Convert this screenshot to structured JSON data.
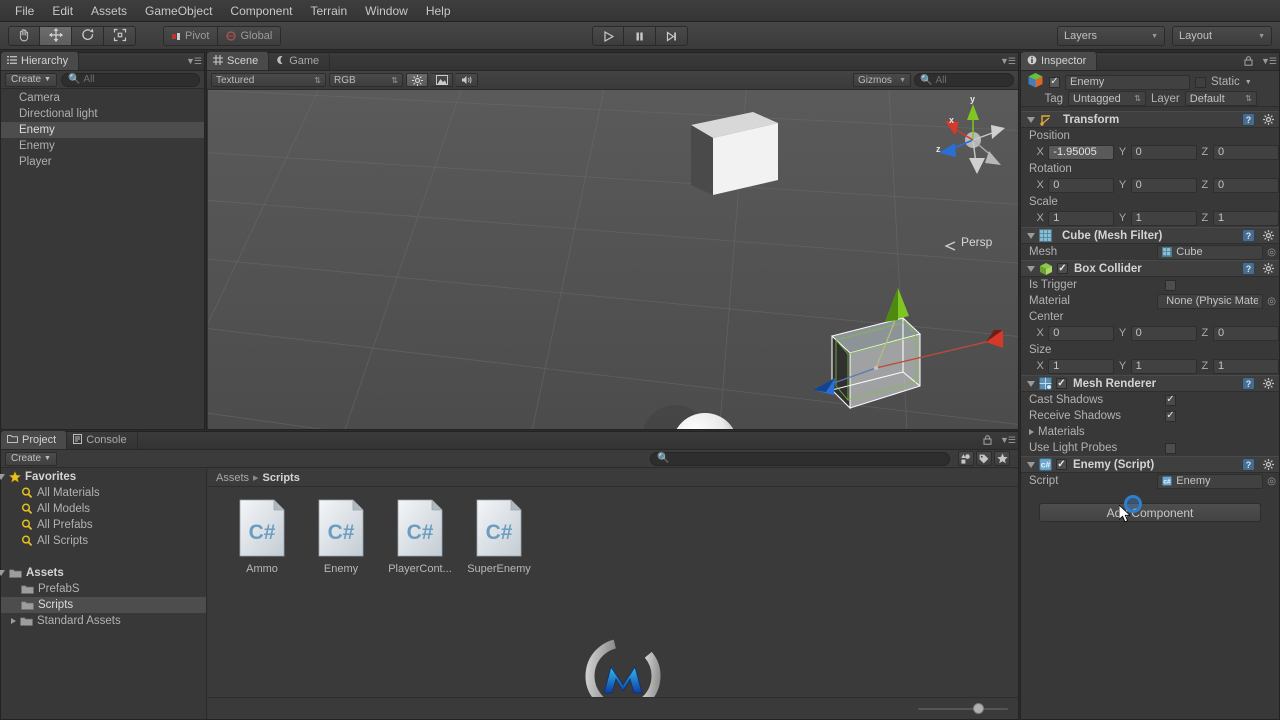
{
  "menu": {
    "items": [
      "File",
      "Edit",
      "Assets",
      "GameObject",
      "Component",
      "Terrain",
      "Window",
      "Help"
    ]
  },
  "toolbar": {
    "tools": [
      {
        "name": "hand-tool",
        "glyph": "✋",
        "active": false
      },
      {
        "name": "move-tool",
        "glyph": "✤",
        "active": true
      },
      {
        "name": "rotate-tool",
        "glyph": "↻",
        "active": false
      },
      {
        "name": "scale-tool",
        "glyph": "⤡",
        "active": false
      }
    ],
    "pivot_label": "Pivot",
    "global_label": "Global",
    "play_label": "▶",
    "pause_label": "❙❙",
    "step_label": "▶❙",
    "layers_label": "Layers",
    "layout_label": "Layout"
  },
  "hierarchy": {
    "tab_label": "Hierarchy",
    "create_label": "Create",
    "search_placeholder": "All",
    "items": [
      {
        "label": "Camera",
        "selected": false
      },
      {
        "label": "Directional light",
        "selected": false
      },
      {
        "label": "Enemy",
        "selected": true
      },
      {
        "label": "Enemy",
        "selected": false
      },
      {
        "label": "Player",
        "selected": false
      }
    ]
  },
  "scene": {
    "tabs": [
      {
        "label": "Scene",
        "active": true
      },
      {
        "label": "Game",
        "active": false
      }
    ],
    "draw_mode": "Textured",
    "render_mode": "RGB",
    "gizmos_label": "Gizmos",
    "gizmos_search_placeholder": "All",
    "persp_label": "Persp",
    "axis_x": "x",
    "axis_y": "y",
    "axis_z": "z"
  },
  "project": {
    "tabs": [
      {
        "label": "Project",
        "active": true
      },
      {
        "label": "Console",
        "active": false
      }
    ],
    "create_label": "Create",
    "search_placeholder": "",
    "tree": [
      {
        "label": "Favorites",
        "icon": "star-icon",
        "depth": 0,
        "bold": true,
        "expanded": true
      },
      {
        "label": "All Materials",
        "icon": "search-icon",
        "depth": 1,
        "bold": false
      },
      {
        "label": "All Models",
        "icon": "search-icon",
        "depth": 1,
        "bold": false
      },
      {
        "label": "All Prefabs",
        "icon": "search-icon",
        "depth": 1,
        "bold": false
      },
      {
        "label": "All Scripts",
        "icon": "search-icon",
        "depth": 1,
        "bold": false
      },
      {
        "label": "",
        "icon": "",
        "depth": 0,
        "bold": false
      },
      {
        "label": "Assets",
        "icon": "folder-icon",
        "depth": 0,
        "bold": true,
        "expanded": true
      },
      {
        "label": "PrefabS",
        "icon": "folder-icon",
        "depth": 1,
        "bold": false
      },
      {
        "label": "Scripts",
        "icon": "folder-icon",
        "depth": 1,
        "bold": false,
        "selected": true
      },
      {
        "label": "Standard Assets",
        "icon": "folder-icon",
        "depth": 1,
        "bold": false,
        "collapsed": true
      }
    ],
    "breadcrumb": [
      "Assets",
      "Scripts"
    ],
    "assets": [
      {
        "label": "Ammo",
        "type": "csharp-script"
      },
      {
        "label": "Enemy",
        "type": "csharp-script"
      },
      {
        "label": "PlayerCont...",
        "type": "csharp-script"
      },
      {
        "label": "SuperEnemy",
        "type": "csharp-script"
      }
    ],
    "zoom_value": 72
  },
  "inspector": {
    "tab_label": "Inspector",
    "object_name": "Enemy",
    "object_enabled": true,
    "static_label": "Static",
    "tag_label": "Tag",
    "tag_value": "Untagged",
    "layer_label": "Layer",
    "layer_value": "Default",
    "components": [
      {
        "name": "Transform",
        "icon": "transform-icon",
        "has_checkbox": false,
        "vectors": [
          {
            "label": "Position",
            "x": "-1.95005",
            "y": "0",
            "z": "0",
            "x_focused": true
          },
          {
            "label": "Rotation",
            "x": "0",
            "y": "0",
            "z": "0",
            "x_focused": false
          },
          {
            "label": "Scale",
            "x": "1",
            "y": "1",
            "z": "1",
            "x_focused": false
          }
        ]
      },
      {
        "name": "Cube (Mesh Filter)",
        "icon": "mesh-filter-icon",
        "has_checkbox": false,
        "rows": [
          {
            "label": "Mesh",
            "value": "Cube",
            "type": "object-field"
          }
        ]
      },
      {
        "name": "Box Collider",
        "icon": "box-collider-icon",
        "has_checkbox": true,
        "checked": true,
        "rows": [
          {
            "label": "Is Trigger",
            "value": "",
            "type": "checkbox",
            "checked": false
          },
          {
            "label": "Material",
            "value": "None (Physic Mater",
            "type": "object-field"
          }
        ],
        "vectors": [
          {
            "label": "Center",
            "x": "0",
            "y": "0",
            "z": "0",
            "x_focused": false
          },
          {
            "label": "Size",
            "x": "1",
            "y": "1",
            "z": "1",
            "x_focused": false
          }
        ]
      },
      {
        "name": "Mesh Renderer",
        "icon": "mesh-renderer-icon",
        "has_checkbox": true,
        "checked": true,
        "rows": [
          {
            "label": "Cast Shadows",
            "value": "",
            "type": "checkbox",
            "checked": true
          },
          {
            "label": "Receive Shadows",
            "value": "",
            "type": "checkbox",
            "checked": true
          },
          {
            "label": "Materials",
            "value": "",
            "type": "foldout"
          },
          {
            "label": "Use Light Probes",
            "value": "",
            "type": "checkbox",
            "checked": false
          }
        ]
      },
      {
        "name": "Enemy (Script)",
        "icon": "script-icon",
        "has_checkbox": true,
        "checked": true,
        "rows": [
          {
            "label": "Script",
            "value": "Enemy",
            "type": "object-field"
          }
        ]
      }
    ],
    "add_component_label": "Add Component"
  },
  "colors": {
    "window_bg": "#2c2c2c",
    "panel_bg": "#383838",
    "selection": "#4d4d4d",
    "axis_x": "#d03c2f",
    "axis_y": "#6fcb2a",
    "axis_z": "#2f6fd0",
    "csharp_blue": "#6a9dc0",
    "folder": "#9d9d9d",
    "favorite_star": "#e8c020"
  }
}
